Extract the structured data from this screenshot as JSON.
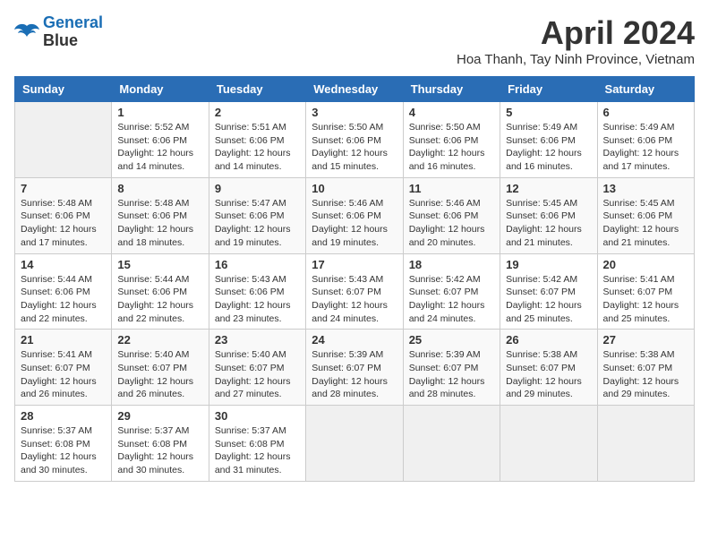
{
  "logo": {
    "line1": "General",
    "line2": "Blue"
  },
  "title": "April 2024",
  "location": "Hoa Thanh, Tay Ninh Province, Vietnam",
  "days_header": [
    "Sunday",
    "Monday",
    "Tuesday",
    "Wednesday",
    "Thursday",
    "Friday",
    "Saturday"
  ],
  "weeks": [
    [
      {
        "day": "",
        "info": ""
      },
      {
        "day": "1",
        "info": "Sunrise: 5:52 AM\nSunset: 6:06 PM\nDaylight: 12 hours\nand 14 minutes."
      },
      {
        "day": "2",
        "info": "Sunrise: 5:51 AM\nSunset: 6:06 PM\nDaylight: 12 hours\nand 14 minutes."
      },
      {
        "day": "3",
        "info": "Sunrise: 5:50 AM\nSunset: 6:06 PM\nDaylight: 12 hours\nand 15 minutes."
      },
      {
        "day": "4",
        "info": "Sunrise: 5:50 AM\nSunset: 6:06 PM\nDaylight: 12 hours\nand 16 minutes."
      },
      {
        "day": "5",
        "info": "Sunrise: 5:49 AM\nSunset: 6:06 PM\nDaylight: 12 hours\nand 16 minutes."
      },
      {
        "day": "6",
        "info": "Sunrise: 5:49 AM\nSunset: 6:06 PM\nDaylight: 12 hours\nand 17 minutes."
      }
    ],
    [
      {
        "day": "7",
        "info": "Sunrise: 5:48 AM\nSunset: 6:06 PM\nDaylight: 12 hours\nand 17 minutes."
      },
      {
        "day": "8",
        "info": "Sunrise: 5:48 AM\nSunset: 6:06 PM\nDaylight: 12 hours\nand 18 minutes."
      },
      {
        "day": "9",
        "info": "Sunrise: 5:47 AM\nSunset: 6:06 PM\nDaylight: 12 hours\nand 19 minutes."
      },
      {
        "day": "10",
        "info": "Sunrise: 5:46 AM\nSunset: 6:06 PM\nDaylight: 12 hours\nand 19 minutes."
      },
      {
        "day": "11",
        "info": "Sunrise: 5:46 AM\nSunset: 6:06 PM\nDaylight: 12 hours\nand 20 minutes."
      },
      {
        "day": "12",
        "info": "Sunrise: 5:45 AM\nSunset: 6:06 PM\nDaylight: 12 hours\nand 21 minutes."
      },
      {
        "day": "13",
        "info": "Sunrise: 5:45 AM\nSunset: 6:06 PM\nDaylight: 12 hours\nand 21 minutes."
      }
    ],
    [
      {
        "day": "14",
        "info": "Sunrise: 5:44 AM\nSunset: 6:06 PM\nDaylight: 12 hours\nand 22 minutes."
      },
      {
        "day": "15",
        "info": "Sunrise: 5:44 AM\nSunset: 6:06 PM\nDaylight: 12 hours\nand 22 minutes."
      },
      {
        "day": "16",
        "info": "Sunrise: 5:43 AM\nSunset: 6:06 PM\nDaylight: 12 hours\nand 23 minutes."
      },
      {
        "day": "17",
        "info": "Sunrise: 5:43 AM\nSunset: 6:07 PM\nDaylight: 12 hours\nand 24 minutes."
      },
      {
        "day": "18",
        "info": "Sunrise: 5:42 AM\nSunset: 6:07 PM\nDaylight: 12 hours\nand 24 minutes."
      },
      {
        "day": "19",
        "info": "Sunrise: 5:42 AM\nSunset: 6:07 PM\nDaylight: 12 hours\nand 25 minutes."
      },
      {
        "day": "20",
        "info": "Sunrise: 5:41 AM\nSunset: 6:07 PM\nDaylight: 12 hours\nand 25 minutes."
      }
    ],
    [
      {
        "day": "21",
        "info": "Sunrise: 5:41 AM\nSunset: 6:07 PM\nDaylight: 12 hours\nand 26 minutes."
      },
      {
        "day": "22",
        "info": "Sunrise: 5:40 AM\nSunset: 6:07 PM\nDaylight: 12 hours\nand 26 minutes."
      },
      {
        "day": "23",
        "info": "Sunrise: 5:40 AM\nSunset: 6:07 PM\nDaylight: 12 hours\nand 27 minutes."
      },
      {
        "day": "24",
        "info": "Sunrise: 5:39 AM\nSunset: 6:07 PM\nDaylight: 12 hours\nand 28 minutes."
      },
      {
        "day": "25",
        "info": "Sunrise: 5:39 AM\nSunset: 6:07 PM\nDaylight: 12 hours\nand 28 minutes."
      },
      {
        "day": "26",
        "info": "Sunrise: 5:38 AM\nSunset: 6:07 PM\nDaylight: 12 hours\nand 29 minutes."
      },
      {
        "day": "27",
        "info": "Sunrise: 5:38 AM\nSunset: 6:07 PM\nDaylight: 12 hours\nand 29 minutes."
      }
    ],
    [
      {
        "day": "28",
        "info": "Sunrise: 5:37 AM\nSunset: 6:08 PM\nDaylight: 12 hours\nand 30 minutes."
      },
      {
        "day": "29",
        "info": "Sunrise: 5:37 AM\nSunset: 6:08 PM\nDaylight: 12 hours\nand 30 minutes."
      },
      {
        "day": "30",
        "info": "Sunrise: 5:37 AM\nSunset: 6:08 PM\nDaylight: 12 hours\nand 31 minutes."
      },
      {
        "day": "",
        "info": ""
      },
      {
        "day": "",
        "info": ""
      },
      {
        "day": "",
        "info": ""
      },
      {
        "day": "",
        "info": ""
      }
    ]
  ]
}
